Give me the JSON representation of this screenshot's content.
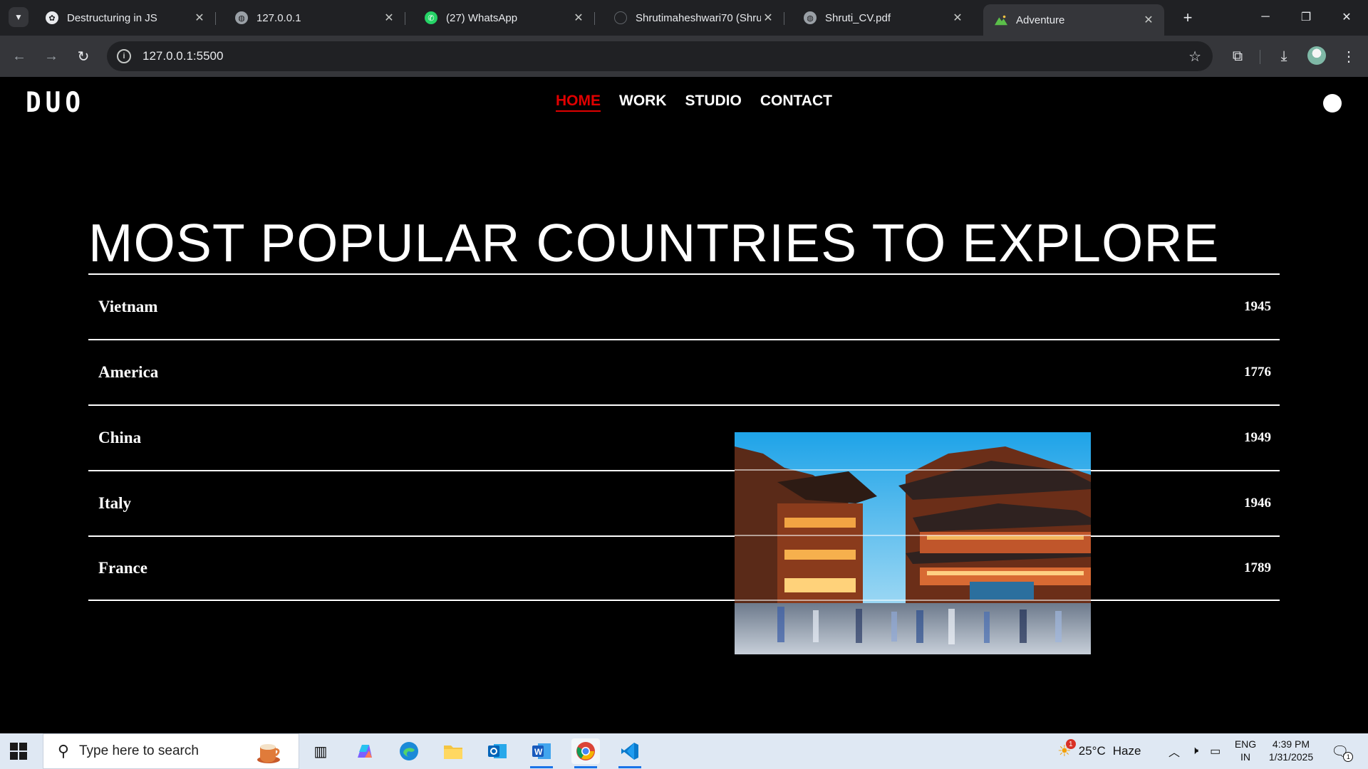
{
  "browser": {
    "tabs": [
      {
        "title": "Destructuring in JS",
        "icon": "openai-icon"
      },
      {
        "title": "127.0.0.1",
        "icon": "globe-icon"
      },
      {
        "title": "(27) WhatsApp",
        "icon": "whatsapp-icon"
      },
      {
        "title": "Shrutimaheshwari70 (Shruti",
        "icon": "github-icon"
      },
      {
        "title": "Shruti_CV.pdf",
        "icon": "globe-icon"
      },
      {
        "title": "Adventure",
        "icon": "mountain-icon",
        "active": true
      }
    ],
    "new_tab": "+",
    "url": "127.0.0.1:5500"
  },
  "site": {
    "logo": "DUO",
    "nav": [
      {
        "label": "HOME",
        "active": true
      },
      {
        "label": "WORK"
      },
      {
        "label": "STUDIO"
      },
      {
        "label": "CONTACT"
      }
    ],
    "accent_color": "#e00000",
    "hero_title": "MOST POPULAR COUNTRIES TO EXPLORE",
    "countries": [
      {
        "name": "Vietnam",
        "year": "1945"
      },
      {
        "name": "America",
        "year": "1776"
      },
      {
        "name": "China",
        "year": "1949"
      },
      {
        "name": "Italy",
        "year": "1946"
      },
      {
        "name": "France",
        "year": "1789"
      }
    ],
    "hover_preview": {
      "country": "China",
      "image": "chinese-temple-street-photo"
    }
  },
  "taskbar": {
    "search_placeholder": "Type here to search",
    "weather": {
      "temp": "25°C",
      "condition": "Haze",
      "badge": "1"
    },
    "language": {
      "line1": "ENG",
      "line2": "IN"
    },
    "clock": {
      "time": "4:39 PM",
      "date": "1/31/2025"
    },
    "notifications": "1"
  }
}
